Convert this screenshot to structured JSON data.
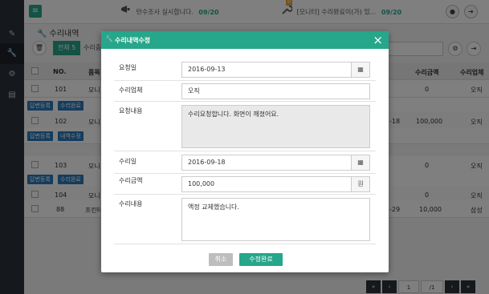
{
  "topbar": {
    "menu_icon": "hamburger-icon",
    "notice1_text": "만수조사 실시합니다.",
    "notice1_count": "09/20",
    "notice2_text": "[모니터] 수리완료이(가) 있...",
    "notice2_count": "09/20",
    "notice2_badge": "0"
  },
  "page": {
    "title": "수리내역",
    "tab_all": "전체 5",
    "tab_repair": "수리중"
  },
  "table": {
    "headers": [
      "NO.",
      "품목",
      "수리금액",
      "수리업체"
    ],
    "rows": [
      {
        "no": "101",
        "item": "모니",
        "amount": "0",
        "vendor": "오직"
      },
      {
        "no": "102",
        "item": "모니",
        "date": "-18",
        "amount": "100,000",
        "vendor": "오직"
      },
      {
        "no": "103",
        "item": "모니",
        "amount": "0",
        "vendor": "오직"
      },
      {
        "no": "104",
        "item": "모니",
        "amount": "0",
        "vendor": "오직"
      },
      {
        "no": "88",
        "item": "프린터",
        "date": "-29",
        "amount": "10,000",
        "vendor": "삼성"
      }
    ],
    "actions": {
      "answer": "답변등록",
      "repair_done": "수리완료",
      "edit_history": "내역수정"
    }
  },
  "pager": {
    "first": "«",
    "prev": "‹",
    "page": "1",
    "total": "/1",
    "next": "›",
    "last": "»"
  },
  "modal": {
    "title": "수리내역수정",
    "close": "×",
    "fields": {
      "request_date_label": "요청일",
      "request_date_value": "2016-09-13",
      "vendor_label": "수리업체",
      "vendor_value": "오직",
      "request_content_label": "요청내용",
      "request_content_value": "수리요청합니다. 화면이 깨졌어요.",
      "repair_date_label": "수리일",
      "repair_date_value": "2016-09-18",
      "amount_label": "수리금액",
      "amount_value": "100,000",
      "amount_unit": "원",
      "repair_content_label": "수리내용",
      "repair_content_value": "액정 교체했습니다."
    },
    "cancel_label": "취소",
    "save_label": "수정완료"
  },
  "colors": {
    "accent": "#26a68a",
    "sidebar": "#2a3038",
    "action_blue": "#2b79b8"
  }
}
